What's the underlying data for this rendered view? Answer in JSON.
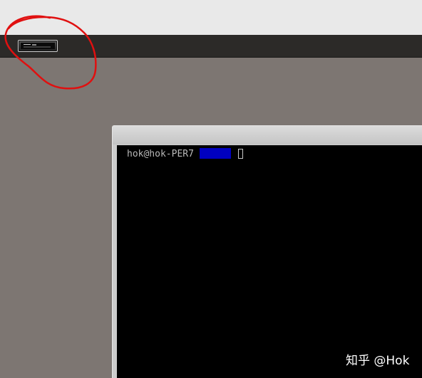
{
  "panel": {
    "taskbar_button_icon": "terminal-window-thumbnail-icon"
  },
  "terminal": {
    "prompt": "hok@hok-PER7",
    "highlight_color": "#0000c0",
    "background_color": "#000000",
    "text_color": "#b9b9b9"
  },
  "annotation": {
    "shape": "circle",
    "color": "#e01010"
  },
  "watermark": {
    "text": "知乎 @Hok"
  },
  "colors": {
    "desktop": "#7d7672",
    "panel": "#2c2a28",
    "top_strip": "#e9e9e9",
    "window_frame": "#cdcdcd"
  }
}
